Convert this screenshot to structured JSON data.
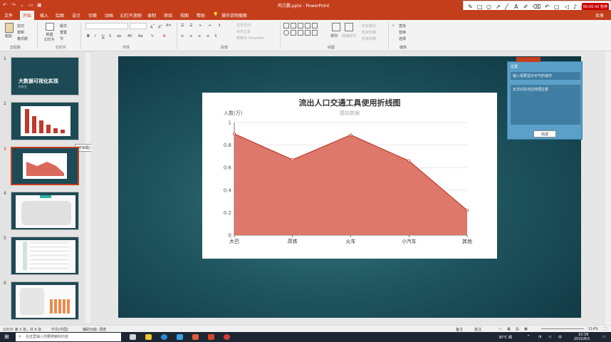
{
  "window": {
    "title": "丙方鹏.pptx  -  PowerPoint",
    "record_time": "00:00:42 暂停",
    "share_label": "共享"
  },
  "tabs": [
    "文件",
    "开始",
    "插入",
    "绘图",
    "设计",
    "切换",
    "动画",
    "幻灯片放映",
    "录制",
    "审阅",
    "视图",
    "帮助",
    "操作说明搜索"
  ],
  "ribbon": {
    "clipboard": {
      "label": "剪贴板",
      "paste": "粘贴",
      "cut": "剪切",
      "copy": "复制",
      "format_painter": "格式刷"
    },
    "slides": {
      "label": "幻灯片",
      "new_slide": "新建\n幻灯片",
      "layout": "版式",
      "reset": "重置",
      "section": "节"
    },
    "font": {
      "label": "字体",
      "bold": "B",
      "italic": "I",
      "underline": "U",
      "strike": "S",
      "spacing": "AV"
    },
    "paragraph": {
      "label": "段落",
      "text_direction": "文字方向",
      "align_text": "对齐文本",
      "convert_smartart": "转换为 SmartArt"
    },
    "drawing": {
      "label": "绘图",
      "arrange": "排列",
      "quick_styles": "快速样式",
      "shape_fill": "形状填充",
      "shape_outline": "形状轮廓",
      "shape_effects": "形状效果"
    },
    "editing": {
      "label": "编辑",
      "find": "查找",
      "replace": "替换",
      "select": "选择"
    }
  },
  "slides": [
    {
      "num": "1",
      "title": "大数据可视化实现",
      "subtitle": "何先生"
    },
    {
      "num": "2"
    },
    {
      "num": "3"
    },
    {
      "num": "4"
    },
    {
      "num": "5"
    },
    {
      "num": "6"
    }
  ],
  "tooltip": "(无标题)",
  "chart_data": {
    "type": "area",
    "title": "流出人口交通工具使用折线图",
    "subtitle": "模拟数据",
    "ylabel": "人数(万)",
    "xlabel": "",
    "categories": [
      "大巴",
      "高铁",
      "火车",
      "小汽车",
      "其他"
    ],
    "values": [
      0.9,
      0.67,
      0.89,
      0.66,
      0.22
    ],
    "ylim": [
      0,
      1
    ],
    "yticks": [
      "0",
      "0.2",
      "0.4",
      "0.6",
      "0.8",
      "1"
    ],
    "fill_color": "#d9695b",
    "line_color": "#c0392b",
    "grid": true
  },
  "dialog": {
    "title": "位置",
    "input_placeholder": "输入需要显示天气的城市",
    "message": "无法识别当前地理位置",
    "ok_button": "完成"
  },
  "status": {
    "slide_info": "幻灯片 第 3 张，共 6 张",
    "language": "中文(中国)",
    "accessibility": "辅助功能: 调查",
    "notes": "备注",
    "comments": "批注",
    "zoom": "114%"
  },
  "taskbar": {
    "search_placeholder": "在这里输入你要搜索的内容",
    "weather": "30°C 晴",
    "time": "10:39",
    "date": "2022/6/1"
  },
  "colors": {
    "accent": "#c43e1c",
    "slide_bg": "#1f5660",
    "dialog_bg": "#5ba0c8"
  }
}
